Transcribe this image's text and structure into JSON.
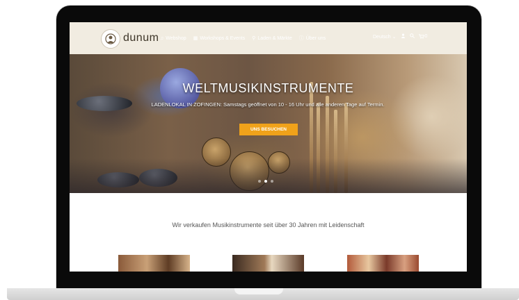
{
  "header": {
    "logo_text": "dunum",
    "nav": [
      {
        "icon": "music-note-icon",
        "glyph": "♫",
        "label": "Webshop"
      },
      {
        "icon": "calendar-icon",
        "glyph": "▦",
        "label": "Workshops & Events"
      },
      {
        "icon": "location-pin-icon",
        "glyph": "⚲",
        "label": "Laden & Märkte"
      },
      {
        "icon": "info-icon",
        "glyph": "ⓘ",
        "label": "Über uns"
      }
    ],
    "language": "Deutsch",
    "cart_count": "0"
  },
  "hero": {
    "title": "WELTMUSIKINSTRUMENTE",
    "subtitle": "LADENLOKAL IN ZOFINGEN: Samstags geöffnet von 10 - 16 Uhr und alle anderen Tage auf Termin.",
    "cta_label": "UNS BESUCHEN",
    "slides": 3,
    "active_slide": 1
  },
  "content": {
    "tagline": "Wir verkaufen Musikinstrumente seit über 30 Jahren mit Leidenschaft"
  },
  "colors": {
    "accent": "#f0a21a",
    "frame": "#0a0a0a"
  }
}
